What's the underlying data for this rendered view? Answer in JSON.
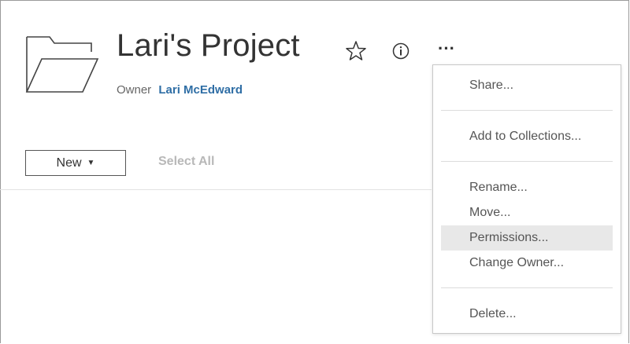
{
  "project": {
    "title": "Lari's Project",
    "owner_label": "Owner",
    "owner_name": "Lari McEdward"
  },
  "icons": {
    "folder": "folder-icon",
    "favorite": "star-outline-icon",
    "info": "info-circle-icon",
    "more": "more-actions-icon",
    "more_glyph": "···"
  },
  "toolbar": {
    "new_label": "New",
    "new_caret": "▼",
    "select_all_label": "Select All"
  },
  "actions_menu": {
    "highlighted": "Permissions...",
    "groups": [
      [
        "Share..."
      ],
      [
        "Add to Collections..."
      ],
      [
        "Rename...",
        "Move...",
        "Permissions...",
        "Change Owner..."
      ],
      [
        "Delete..."
      ]
    ],
    "share": "Share...",
    "add_to_collections": "Add to Collections...",
    "rename": "Rename...",
    "move": "Move...",
    "permissions": "Permissions...",
    "change_owner": "Change Owner...",
    "delete": "Delete..."
  },
  "colors": {
    "title_text": "#333333",
    "owner_link": "#2f6ea5",
    "disabled_text": "#b8b8b8",
    "menu_highlight": "#e8e8e8"
  }
}
